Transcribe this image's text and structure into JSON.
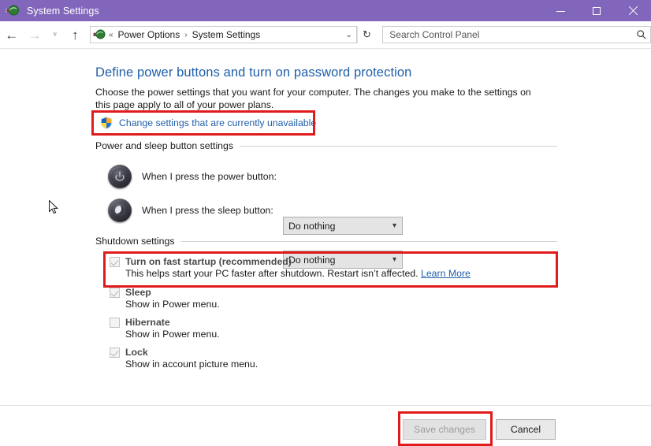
{
  "window": {
    "title": "System Settings",
    "icon": "power-plug-icon",
    "titlebar_color": "#8266bb",
    "controls": {
      "minimize": "Minimize",
      "maximize": "Maximize",
      "close": "Close"
    }
  },
  "navbar": {
    "back": "Back",
    "forward": "Forward",
    "recent": "Recent locations",
    "up": "Up one level",
    "address_icon": "power-plug-icon",
    "breadcrumb_prefix": "«",
    "breadcrumbs": [
      "Power Options",
      "System Settings"
    ],
    "breadcrumb_separator": "›",
    "address_dropdown": "⌄",
    "refresh": "↻"
  },
  "search": {
    "placeholder": "Search Control Panel",
    "value": "",
    "icon": "search-icon"
  },
  "main": {
    "title": "Define power buttons and turn on password protection",
    "description": "Choose the power settings that you want for your computer. The changes you make to the settings on this page apply to all of your power plans.",
    "uac_link": {
      "icon": "uac-shield-icon",
      "label": "Change settings that are currently unavailable"
    },
    "sections": [
      {
        "header": "Power and sleep button settings",
        "rows": [
          {
            "icon": "power-button-icon",
            "label": "When I press the power button:",
            "value": "Do nothing",
            "enabled": false
          },
          {
            "icon": "sleep-button-icon",
            "label": "When I press the sleep button:",
            "value": "Do nothing",
            "enabled": false
          }
        ]
      },
      {
        "header": "Shutdown settings",
        "checkboxes": [
          {
            "title": "Turn on fast startup (recommended)",
            "subtitle_before": "This helps start your PC faster after shutdown. Restart isn’t affected. ",
            "link": "Learn More",
            "checked": true,
            "enabled": false
          },
          {
            "title": "Sleep",
            "subtitle_before": "Show in Power menu.",
            "link": "",
            "checked": true,
            "enabled": false
          },
          {
            "title": "Hibernate",
            "subtitle_before": "Show in Power menu.",
            "link": "",
            "checked": false,
            "enabled": false
          },
          {
            "title": "Lock",
            "subtitle_before": "Show in account picture menu.",
            "link": "",
            "checked": true,
            "enabled": false
          }
        ]
      }
    ]
  },
  "footer": {
    "save_label": "Save changes",
    "save_enabled": false,
    "cancel_label": "Cancel"
  },
  "annotations": {
    "highlight_color": "#e01b1b",
    "boxes": [
      "uac-link-box",
      "fast-startup-box",
      "save-changes-box"
    ]
  }
}
